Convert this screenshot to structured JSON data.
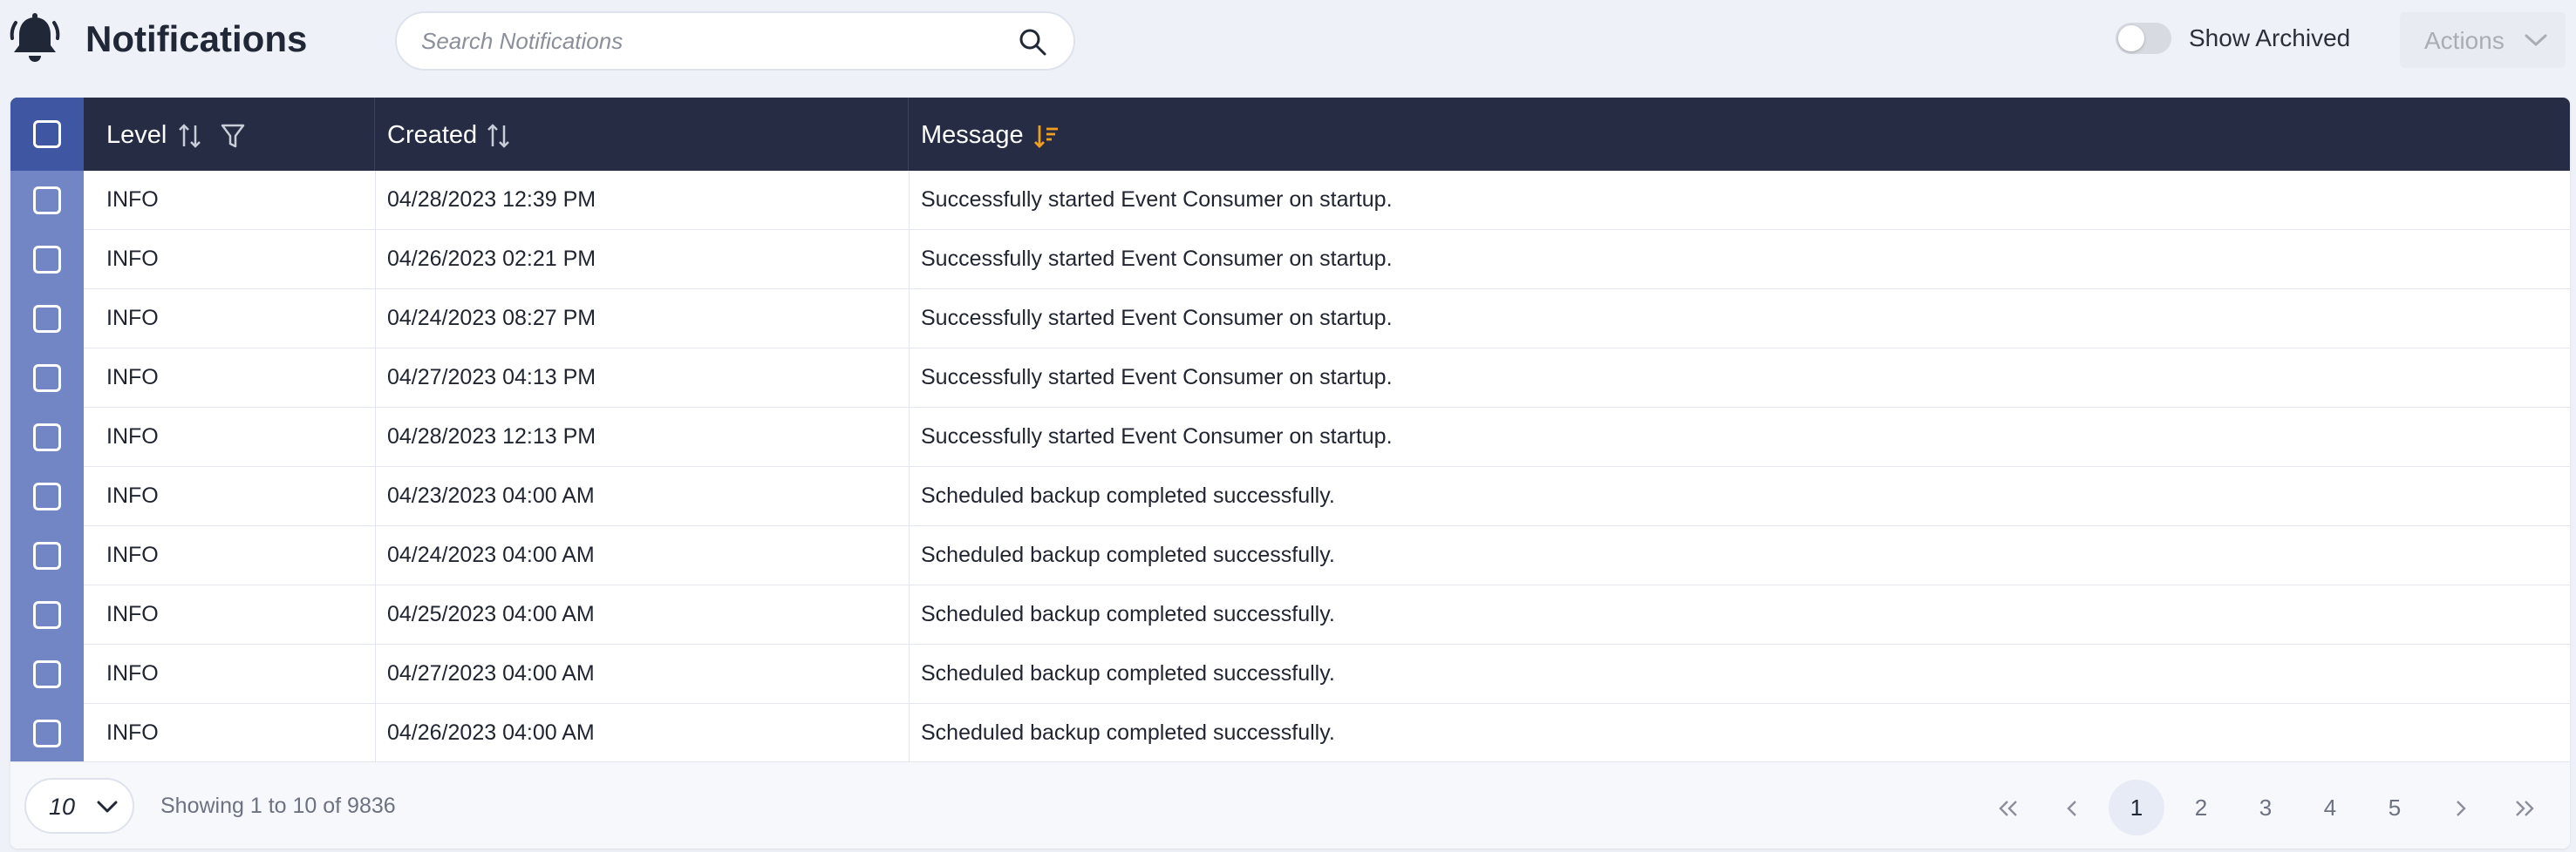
{
  "header": {
    "title": "Notifications",
    "search_placeholder": "Search Notifications",
    "show_archived_label": "Show Archived",
    "show_archived_on": false,
    "actions_label": "Actions"
  },
  "table": {
    "columns": {
      "level": "Level",
      "created": "Created",
      "message": "Message"
    },
    "rows": [
      {
        "level": "INFO",
        "created": "04/28/2023 12:39 PM",
        "message": "Successfully started Event Consumer on startup."
      },
      {
        "level": "INFO",
        "created": "04/26/2023 02:21 PM",
        "message": "Successfully started Event Consumer on startup."
      },
      {
        "level": "INFO",
        "created": "04/24/2023 08:27 PM",
        "message": "Successfully started Event Consumer on startup."
      },
      {
        "level": "INFO",
        "created": "04/27/2023 04:13 PM",
        "message": "Successfully started Event Consumer on startup."
      },
      {
        "level": "INFO",
        "created": "04/28/2023 12:13 PM",
        "message": "Successfully started Event Consumer on startup."
      },
      {
        "level": "INFO",
        "created": "04/23/2023 04:00 AM",
        "message": "Scheduled backup completed successfully."
      },
      {
        "level": "INFO",
        "created": "04/24/2023 04:00 AM",
        "message": "Scheduled backup completed successfully."
      },
      {
        "level": "INFO",
        "created": "04/25/2023 04:00 AM",
        "message": "Scheduled backup completed successfully."
      },
      {
        "level": "INFO",
        "created": "04/27/2023 04:00 AM",
        "message": "Scheduled backup completed successfully."
      },
      {
        "level": "INFO",
        "created": "04/26/2023 04:00 AM",
        "message": "Scheduled backup completed successfully."
      }
    ]
  },
  "footer": {
    "page_size": "10",
    "showing_text": "Showing 1 to 10 of 9836",
    "pages": [
      "1",
      "2",
      "3",
      "4",
      "5"
    ],
    "current_page": "1"
  },
  "colors": {
    "header_bg": "#262c44",
    "checkbox_column": "#7285c4",
    "sort_active": "#f0a020",
    "page_bg": "#eef1f8"
  },
  "icons": {
    "app": "bell-icon",
    "search": "search-icon",
    "sort": "sort-icon",
    "filter": "filter-icon",
    "sort_active": "sort-descending-icon",
    "dropdown": "chevron-down-icon",
    "first": "double-chevron-left-icon",
    "prev": "chevron-left-icon",
    "next": "chevron-right-icon",
    "last": "double-chevron-right-icon"
  }
}
